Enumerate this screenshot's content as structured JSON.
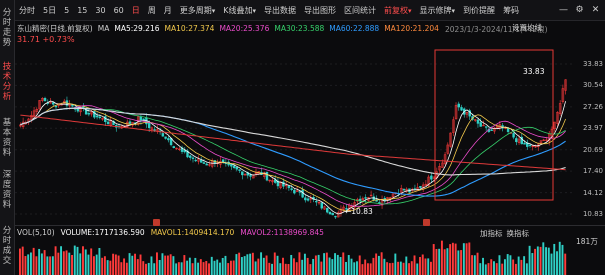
{
  "left_nav": [
    {
      "label": "分时走势",
      "active": false
    },
    {
      "label": "技术分析",
      "active": true
    },
    {
      "label": "基本资料",
      "active": false
    },
    {
      "label": "深度资料",
      "active": false
    },
    {
      "label": "分时成交",
      "active": false
    }
  ],
  "toolbar": {
    "periods": [
      "分时",
      "5日",
      "5",
      "15",
      "30",
      "60",
      "日",
      "周",
      "月"
    ],
    "active_period": "日",
    "menus": [
      "更多周期",
      "K线叠加",
      "导出数据",
      "导出图形",
      "区间统计",
      "前复权",
      "显示修牌",
      "到价提醒",
      "筹码"
    ],
    "active_menu": "前复权",
    "icons": [
      "minimize-icon",
      "gear-icon",
      "close-icon"
    ]
  },
  "stock": {
    "name": "东山精密(日线,前复权)",
    "indicator": "MA",
    "price": "31.71",
    "change_pct": "+0.73%"
  },
  "ma_lines": [
    {
      "label": "MA5:29.216",
      "color": "#ffffff"
    },
    {
      "label": "MA10:27.374",
      "color": "#f2c94c"
    },
    {
      "label": "MA20:25.376",
      "color": "#e94cc9"
    },
    {
      "label": "MA30:23.588",
      "color": "#36d06b"
    },
    {
      "label": "MA60:22.888",
      "color": "#2f9cff"
    },
    {
      "label": "MA120:21.204",
      "color": "#ff8a3d"
    }
  ],
  "range_info": "2023/1/3-2024/11/1(442根)",
  "settings_label": "设置均线",
  "annotations": {
    "high": "33.83",
    "low": "10.83"
  },
  "y_axis_ticks": [
    "33.83",
    "30.54",
    "27.26",
    "23.97",
    "20.69",
    "17.40",
    "14.12",
    "10.83"
  ],
  "volume": {
    "title": "VOL(5,10)",
    "volume": "VOLUME:1717136.590",
    "mavol1": "MAVOL1:1409414.170",
    "mavol2": "MAVOL2:1138969.845",
    "mavol1_color": "#f2c94c",
    "mavol2_color": "#e94cc9",
    "right_labels": [
      "加指标",
      "换指标"
    ],
    "max_label": "181万"
  },
  "chart_data": {
    "type": "line",
    "close_approx": [
      24.5,
      26,
      28.5,
      27.5,
      28,
      27.2,
      26.5,
      25.8,
      25,
      24.2,
      24.8,
      25.5,
      24,
      23.2,
      21.5,
      20,
      19.2,
      18.5,
      19,
      18,
      17.5,
      16.8,
      17.2,
      16,
      15.2,
      14.5,
      13.5,
      12.8,
      11.5,
      10.83,
      12,
      13.2,
      13.6,
      12.8,
      13.8,
      14.6,
      14.2,
      15.5,
      17,
      20,
      27.5,
      26,
      24.5,
      23.5,
      24.2,
      23,
      21.5,
      21,
      22,
      24.5,
      31.71
    ],
    "ylim": [
      10.83,
      33.83
    ],
    "up_color": "#ff3b3b",
    "down_color": "#2fd0c6"
  }
}
